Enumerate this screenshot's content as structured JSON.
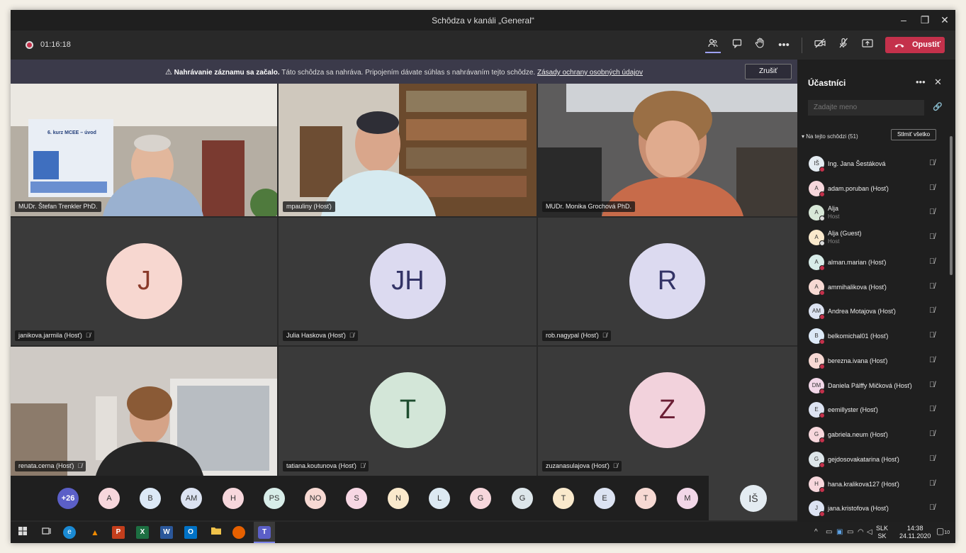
{
  "window": {
    "title": "Schôdza v kanáli „General“"
  },
  "toolbar": {
    "timer": "01:16:18",
    "leave_label": "Opustiť"
  },
  "banner": {
    "bold": "Nahrávanie záznamu sa začalo.",
    "text": "Táto schôdza sa nahráva. Pripojením dávate súhlas s nahrávaním tejto schôdze.",
    "link": "Zásady ochrany osobných údajov",
    "cancel_label": "Zrušiť"
  },
  "tiles": [
    {
      "name": "MUDr. Štefan Trenkler PhD.",
      "mic_muted": false,
      "video": true,
      "slide_title": "6. kurz MCEE – úvod"
    },
    {
      "name": "mpauliny (Hosť)",
      "mic_muted": false,
      "video": true
    },
    {
      "name": "MUDr. Monika Grochová PhD.",
      "mic_muted": false,
      "video": true
    },
    {
      "name": "janikova.jarmila (Hosť)",
      "mic_muted": true,
      "initials": "J",
      "bg": "#f7d7d0",
      "fg": "#8a3a2a"
    },
    {
      "name": "Julia Haskova (Hosť)",
      "mic_muted": true,
      "initials": "JH",
      "bg": "#dcdaf0",
      "fg": "#333366"
    },
    {
      "name": "rob.nagypal (Hosť)",
      "mic_muted": true,
      "initials": "R",
      "bg": "#dcdaf0",
      "fg": "#333366"
    },
    {
      "name": "renata.cerna (Hosť)",
      "mic_muted": true,
      "video": true
    },
    {
      "name": "tatiana.koutunova (Hosť)",
      "mic_muted": true,
      "initials": "T",
      "bg": "#d3e6d8",
      "fg": "#1e4d2f"
    },
    {
      "name": "zuzanasulajova (Hosť)",
      "mic_muted": true,
      "initials": "Z",
      "bg": "#f2d2dc",
      "fg": "#6b1f35"
    }
  ],
  "strip": {
    "overflow": "+26",
    "avatars": [
      {
        "i": "A",
        "bg": "#f7d7dc"
      },
      {
        "i": "B",
        "bg": "#dce9f7"
      },
      {
        "i": "AM",
        "bg": "#dce3f2"
      },
      {
        "i": "H",
        "bg": "#f7d7dc"
      },
      {
        "i": "PS",
        "bg": "#d8ede9"
      },
      {
        "i": "NO",
        "bg": "#f7d9d3"
      },
      {
        "i": "S",
        "bg": "#f7d7e4"
      },
      {
        "i": "N",
        "bg": "#fae9cc"
      },
      {
        "i": "L",
        "bg": "#dce9f2"
      },
      {
        "i": "G",
        "bg": "#f7d7dc"
      },
      {
        "i": "G",
        "bg": "#dde6ea"
      },
      {
        "i": "T",
        "bg": "#fae9cc"
      },
      {
        "i": "E",
        "bg": "#dce3f2"
      },
      {
        "i": "T",
        "bg": "#f7d9d3"
      },
      {
        "i": "M",
        "bg": "#f2d7e8"
      }
    ],
    "me": "IŠ"
  },
  "panel": {
    "title": "Účastníci",
    "search_placeholder": "Zadajte meno",
    "section": "Na tejto schôdzi (51)",
    "mute_all": "Stlmiť všetko",
    "people": [
      {
        "i": "IŠ",
        "name": "Ing. Jana Šestáková",
        "bg": "#e4ecf2"
      },
      {
        "i": "A",
        "name": "adam.poruban (Hosť)",
        "bg": "#f7d7dc"
      },
      {
        "i": "A",
        "name": "Alja",
        "sub": "Host",
        "bg": "#d8e8d8",
        "gray": true
      },
      {
        "i": "A",
        "name": "Alja (Guest)",
        "sub": "Host",
        "bg": "#fae9cc",
        "gray": true
      },
      {
        "i": "A",
        "name": "alman.marian (Hosť)",
        "bg": "#d8ede9"
      },
      {
        "i": "A",
        "name": "ammihalikova (Hosť)",
        "bg": "#f7d9d3"
      },
      {
        "i": "AM",
        "name": "Andrea Motajova (Hosť)",
        "bg": "#dce3f2"
      },
      {
        "i": "B",
        "name": "belkomichal01 (Hosť)",
        "bg": "#dce9f7"
      },
      {
        "i": "B",
        "name": "berezna.ivana (Hosť)",
        "bg": "#f7d9d3"
      },
      {
        "i": "DM",
        "name": "Daniela Pálffy Mičková (Hosť)",
        "bg": "#f2d7e8"
      },
      {
        "i": "E",
        "name": "eemillyster (Hosť)",
        "bg": "#dce3f2"
      },
      {
        "i": "G",
        "name": "gabriela.neum (Hosť)",
        "bg": "#f7d7dc"
      },
      {
        "i": "G",
        "name": "gejdosovakatarina (Hosť)",
        "bg": "#dde6ea"
      },
      {
        "i": "H",
        "name": "hana.kralikova127 (Hosť)",
        "bg": "#f7d7dc"
      },
      {
        "i": "J",
        "name": "jana.kristofova (Hosť)",
        "bg": "#dce3f2"
      }
    ]
  },
  "taskbar": {
    "lang_top": "SLK",
    "lang_bottom": "SK",
    "time": "14:38",
    "date": "24.11.2020",
    "notifications": "10"
  }
}
